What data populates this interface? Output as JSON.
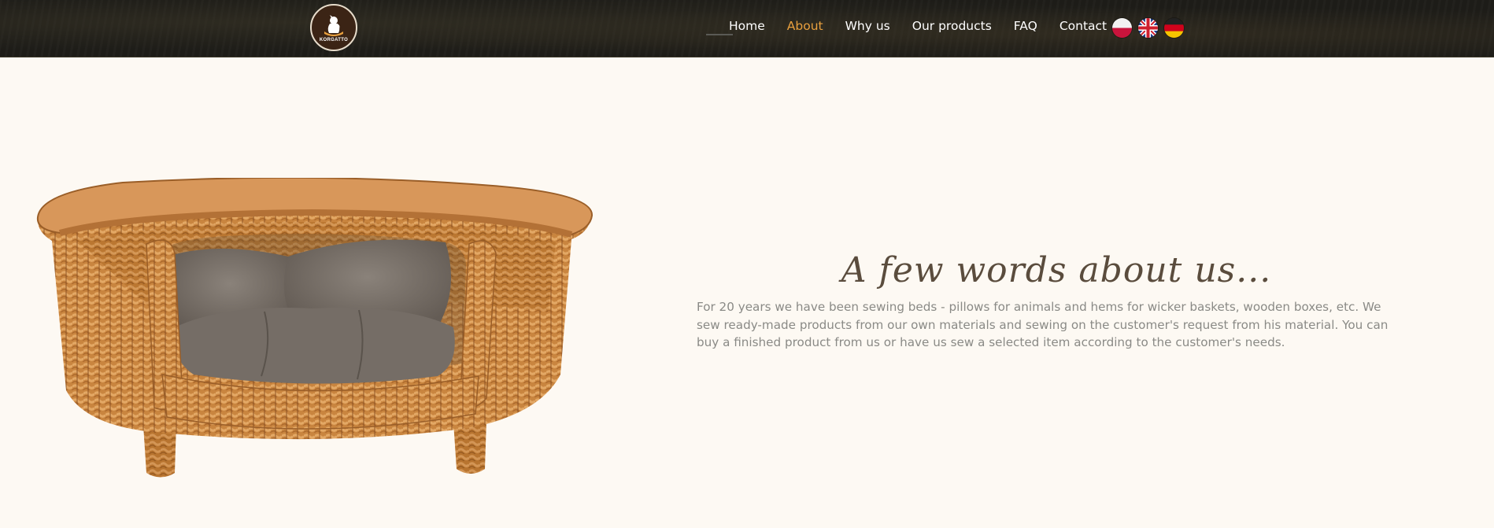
{
  "header": {
    "logo_text": "KORGATTO",
    "nav": [
      {
        "label": "Home",
        "active": false
      },
      {
        "label": "About",
        "active": true
      },
      {
        "label": "Why us",
        "active": false
      },
      {
        "label": "Our products",
        "active": false
      },
      {
        "label": "FAQ",
        "active": false
      },
      {
        "label": "Contact",
        "active": false
      }
    ],
    "languages": [
      {
        "icon": "flag-poland-icon"
      },
      {
        "icon": "flag-uk-icon"
      },
      {
        "icon": "flag-germany-icon"
      }
    ],
    "active_color": "#e9a03e"
  },
  "about": {
    "heading": "A few words about us...",
    "text": "For 20 years we have been sewing beds - pillows for animals and hems for wicker baskets, wooden boxes, etc. We sew ready-made products from our own materials and sewing on the customer's request from his material. You can buy a finished product from us or have us sew a selected item according to the customer's needs."
  },
  "colors": {
    "background": "#fdf9f3",
    "header": "#1d1c18",
    "heading": "#5a4c3d",
    "body_text": "#8a8a86"
  }
}
